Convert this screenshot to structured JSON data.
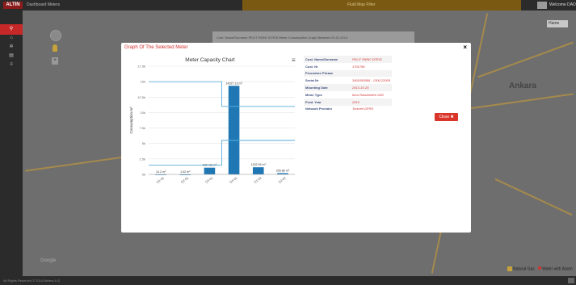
{
  "app": {
    "logo": "ALTIN",
    "title": "Dashboard Meters",
    "banner": "Fluid Map Filter",
    "user": "Welcome DAD"
  },
  "sidebar": {
    "items": [
      {
        "icon": "map-marker-icon",
        "glyph": "⚲"
      },
      {
        "icon": "home-icon",
        "glyph": "⌂"
      },
      {
        "icon": "settings-icon",
        "glyph": "✲"
      },
      {
        "icon": "chart-icon",
        "glyph": "▤"
      },
      {
        "icon": "list-icon",
        "glyph": "≡"
      }
    ]
  },
  "map": {
    "city_label": "Ankara",
    "map_type": "Hame",
    "info_text": "Cust. Name/Surname   PELIT PARK SITESI          Meter Consumption Graph Between 20.01.2014",
    "google_label": "Google",
    "legend": {
      "gas": "Natural Gas",
      "water": "Water with Alarm"
    }
  },
  "footer": {
    "copyright": "All Rights Reserved © 2014 Meters A.Ş."
  },
  "modal": {
    "title": "Graph Of The Selected Meter",
    "close": "×",
    "details": [
      {
        "key": "Cust. Name/Surname",
        "value": "PELIT PARK SITESI"
      },
      {
        "key": "Cust. Nr",
        "value": "1701786"
      },
      {
        "key": "Procedure Phrase",
        "value": ""
      },
      {
        "key": "Serial Nr",
        "value": "3401050086 - 1300.22005"
      },
      {
        "key": "Mounting Date",
        "value": "2013-10-25"
      },
      {
        "key": "Meter Type",
        "value": "Itron Rotarimetre G40"
      },
      {
        "key": "Prod. Year",
        "value": "2013"
      },
      {
        "key": "Network Provider",
        "value": "Turkcell GPRS"
      }
    ],
    "close_button": "Close ✖"
  },
  "chart_data": {
    "type": "bar",
    "title": "Meter Capacity Chart",
    "ylabel": "Consumption m³",
    "ylim": [
      0,
      17500
    ],
    "ticks": [
      "0k",
      "2.5k",
      "5k",
      "7.5k",
      "10k",
      "12.5k",
      "15k",
      "17.5k"
    ],
    "categories": [
      "Q1-01",
      "Q2-01",
      "Q3-01",
      "Q4-01",
      "Q1-02",
      "Q2-02"
    ],
    "values": [
      14.2,
      1.02,
      1084.33,
      14327.13,
      1152.93,
      205.86
    ],
    "data_labels": [
      "14.2 m³",
      "1.02 m³",
      "1084.33 m³",
      "14327.13 m³",
      "1152.93 m³",
      "205.86 m³"
    ],
    "threshold_series": [
      {
        "color": "#5aaedc",
        "segments": [
          [
            -0.5,
            15000,
            2.5
          ],
          [
            2.5,
            11000,
            5.5
          ]
        ]
      },
      {
        "color": "#5aaedc",
        "segments": [
          [
            -0.5,
            1500,
            2.5
          ],
          [
            2.5,
            5500,
            5.5
          ]
        ]
      }
    ],
    "bar_color": "#1f78b4",
    "grid": true
  }
}
